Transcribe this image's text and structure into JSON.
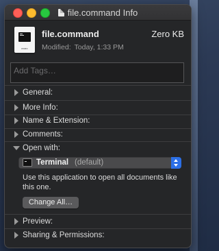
{
  "window": {
    "title": "file.command Info"
  },
  "file": {
    "name": "file.command",
    "size": "Zero KB",
    "modified_label": "Modified:",
    "modified_value": "Today, 1:33 PM",
    "icon_caption": "exec"
  },
  "tags": {
    "placeholder": "Add Tags…"
  },
  "sections": {
    "general": "General:",
    "more_info": "More Info:",
    "name_extension": "Name & Extension:",
    "comments": "Comments:",
    "open_with": "Open with:",
    "preview": "Preview:",
    "sharing": "Sharing & Permissions:"
  },
  "open_with": {
    "app_name": "Terminal",
    "app_note": "(default)",
    "description": "Use this application to open all documents like this one.",
    "change_all_label": "Change All…"
  },
  "colors": {
    "accent": "#2c6fe6",
    "window_bg": "#252628"
  }
}
